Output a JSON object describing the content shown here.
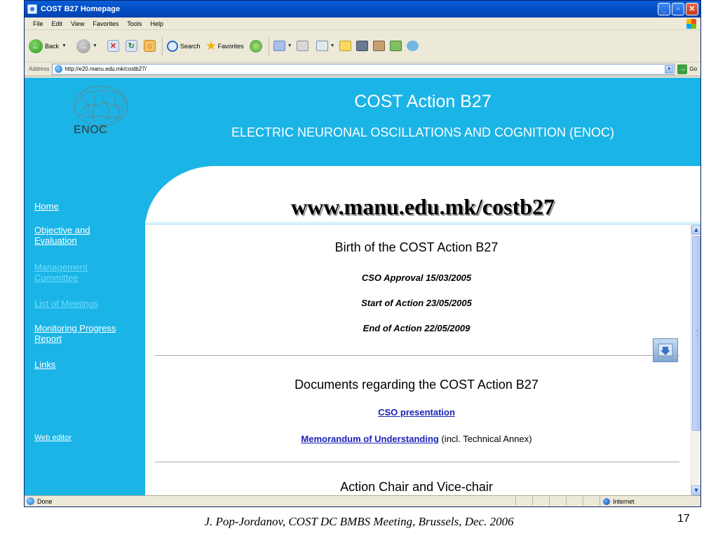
{
  "window": {
    "title": "COST B27 Homepage"
  },
  "menu": [
    "File",
    "Edit",
    "View",
    "Favorites",
    "Tools",
    "Help"
  ],
  "toolbar": {
    "back_label": "Back",
    "search_label": "Search",
    "favorites_label": "Favorites"
  },
  "address": {
    "label": "Address",
    "url": "http://e20.manu.edu.mk/costb27/",
    "go_label": "Go"
  },
  "page": {
    "logo_text": "ENOC",
    "header_title": "COST Action B27",
    "header_subtitle": "ELECTRIC NEURONAL OSCILLATIONS AND COGNITION (ENOC)",
    "url_heading": "www.manu.edu.mk/costb27",
    "nav": [
      {
        "label": "Home"
      },
      {
        "label": "Objective and Evaluation"
      },
      {
        "label": "Management Committee"
      },
      {
        "label": "List of Meetings"
      },
      {
        "label": "Monitoring Progress Report"
      },
      {
        "label": "Links"
      },
      {
        "label": "Web editor"
      }
    ],
    "birth": {
      "title": "Birth of the COST Action B27",
      "lines": [
        "CSO Approval 15/03/2005",
        "Start of Action 23/05/2005",
        "End of Action 22/05/2009"
      ]
    },
    "documents": {
      "title": "Documents regarding the COST Action B27",
      "cso_link": "CSO presentation",
      "mou_link": "Memorandum of Understanding",
      "mou_note": " (incl. Technical Annex)"
    },
    "chair_title": "Action Chair and Vice-chair"
  },
  "status": {
    "text": "Done",
    "zone": "Internet"
  },
  "footer": {
    "caption": "J. Pop-Jordanov, COST DC BMBS Meeting, Brussels, Dec. 2006",
    "page_number": "17"
  },
  "colors": {
    "accent": "#1bb4e6",
    "link": "#1a22b8",
    "titlebar": "#0350c8"
  },
  "icons": [
    "ie-icon",
    "back-icon",
    "forward-icon",
    "stop-icon",
    "refresh-icon",
    "home-icon",
    "search-icon",
    "favorites-star-icon",
    "history-icon",
    "mail-icon",
    "print-icon",
    "edit-icon",
    "messenger-icon",
    "go-arrow-icon",
    "globe-icon",
    "brain-logo-icon",
    "scroll-down-icon"
  ]
}
